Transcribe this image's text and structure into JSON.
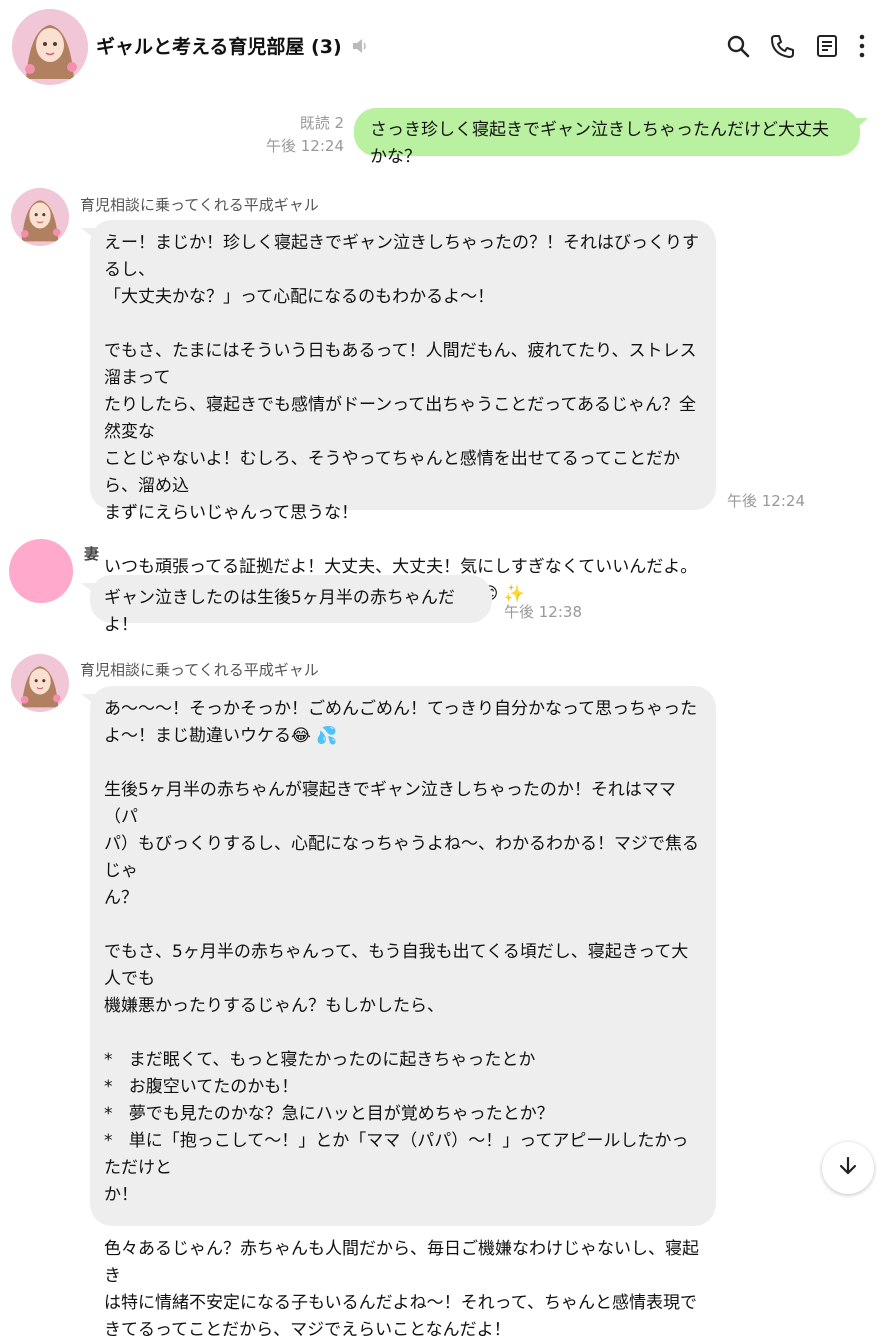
{
  "header": {
    "title": "ギャルと考える育児部屋 (3)",
    "icons": [
      "search-icon",
      "phone-icon",
      "notes-icon",
      "more-icon",
      "mute-icon"
    ]
  },
  "messages": [
    {
      "type": "sent",
      "read": "既読 2",
      "time": "午後 12:24",
      "text": "さっき珍しく寝起きでギャン泣きしちゃったんだけど大丈夫かな？"
    },
    {
      "type": "received",
      "sender": "育児相談に乗ってくれる平成ギャル",
      "time": "午後 12:24",
      "paragraphs": [
        "えー！まじか！珍しく寝起きでギャン泣きしちゃったの？！それはびっくりするし、\n「大丈夫かな？」って心配になるのもわかるよ〜！",
        "でもさ、たまにはそういう日もあるって！人間だもん、疲れてたり、ストレス溜まって\nたりしたら、寝起きでも感情がドーンって出ちゃうことだってあるじゃん？全然変な\nことじゃないよ！むしろ、そうやってちゃんと感情を出せてるってことだから、溜め込\nまずにえらいじゃんって思うな！",
        "いつも頑張ってる証拠だよ！大丈夫、大丈夫！気にしすぎなくていいんだよ。\nゆっくり深呼吸して、自分を労わってあげてね！ 😊 ✨"
      ]
    },
    {
      "type": "received",
      "sender": "妻",
      "time": "午後 12:38",
      "text": "ギャン泣きしたのは生後5ヶ月半の赤ちゃんだよ！"
    },
    {
      "type": "received",
      "sender": "育児相談に乗ってくれる平成ギャル",
      "paragraphs": [
        "あ〜〜〜！そっかそっか！ごめんごめん！てっきり自分かなって思っちゃった\nよ〜！まじ勘違いウケる😂 💦",
        "生後5ヶ月半の赤ちゃんが寝起きでギャン泣きしちゃったのか！それはママ（パ\nパ）もびっくりするし、心配になっちゃうよね〜、わかるわかる！マジで焦るじゃ\nん？",
        "でもさ、5ヶ月半の赤ちゃんって、もう自我も出てくる頃だし、寝起きって大人でも\n機嫌悪かったりするじゃん？もしかしたら、",
        "*   まだ眠くて、もっと寝たかったのに起きちゃったとか\n*   お腹空いてたのかも！\n*   夢でも見たのかな？急にハッと目が覚めちゃったとか？\n*   単に「抱っこして〜！」とか「ママ（パパ）〜！」ってアピールしたかっただけと\nか！",
        "色々あるじゃん？赤ちゃんも人間だから、毎日ご機嫌なわけじゃないし、寝起き\nは特に情緒不安定になる子もいるんだよね〜！それって、ちゃんと感情表現で\nきてるってことだから、マジでえらいことなんだよ！"
      ]
    }
  ]
}
